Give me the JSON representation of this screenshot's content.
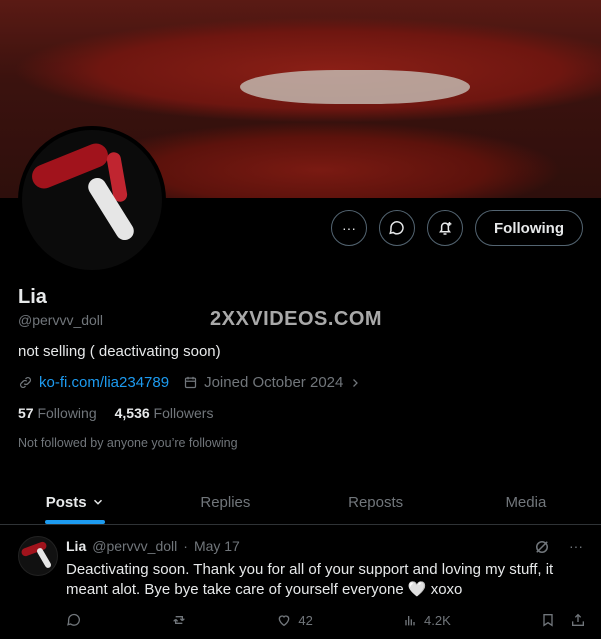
{
  "profile": {
    "name": "Lia",
    "handle": "@pervvv_doll",
    "bio": "not selling ( deactivating soon)",
    "link": "ko-fi.com/lia234789",
    "joined": "Joined October 2024",
    "following_count": "57",
    "following_label": "Following",
    "followers_count": "4,536",
    "followers_label": "Followers",
    "not_followed": "Not followed by anyone you’re following",
    "watermark": "2XXVIDEOS.COM"
  },
  "actions": {
    "more_label": "···",
    "following_button": "Following"
  },
  "tabs": [
    {
      "label": "Posts"
    },
    {
      "label": "Replies"
    },
    {
      "label": "Reposts"
    },
    {
      "label": "Media"
    }
  ],
  "post": {
    "name": "Lia",
    "handle": "@pervvv_doll",
    "dot": "·",
    "date": "May 17",
    "text": "Deactivating soon. Thank you for all of your support and loving my stuff, it meant alot. Bye bye take care of yourself everyone 🤍 xoxo",
    "likes": "42",
    "views": "4.2K",
    "more_label": "···"
  },
  "colors": {
    "accent": "#1d9bf0",
    "muted": "#71767b",
    "text": "#e7e9ea",
    "background": "#000000"
  },
  "icons": [
    "more-icon",
    "message-icon",
    "notify-icon",
    "link-icon",
    "calendar-icon",
    "chevron-right-icon",
    "chevron-down-icon",
    "grok-icon",
    "reply-icon",
    "repost-icon",
    "like-icon",
    "views-icon",
    "bookmark-icon",
    "share-icon"
  ]
}
